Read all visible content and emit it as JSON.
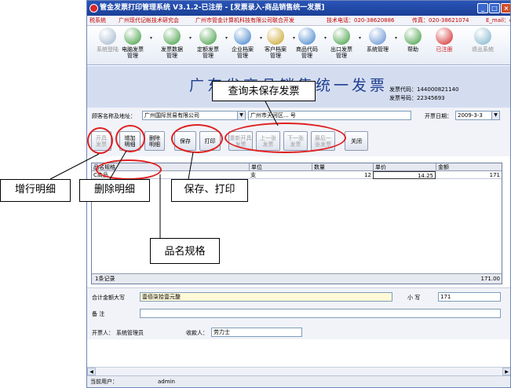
{
  "window": {
    "title": "管金发票打印管理系统 V3.1.2-已注册 - [发票录入-商品销售统一发票]",
    "controls": [
      "_",
      "□",
      "×"
    ]
  },
  "infobar": {
    "system": "税系统",
    "research": "广州现代记帐技术研究会",
    "company": "广州市管金计算机科技有限公司联合开发",
    "phone": "技术电话：020-38620886",
    "fax": "传真：020-38621074",
    "email": "E_mail：ev"
  },
  "toolbar": {
    "items": [
      {
        "label": "系统登陆",
        "icon": "login-icon",
        "color": "#9fb6cc",
        "disabled": true
      },
      {
        "label": "电脑发票\n管理",
        "icon": "computer-invoice-icon",
        "color": "#3a9a3a",
        "disabled": false
      },
      {
        "label": "发票数据\n管理",
        "icon": "invoice-data-icon",
        "color": "#3a9a3a",
        "disabled": false
      },
      {
        "label": "定额发票\n管理",
        "icon": "fixed-invoice-icon",
        "color": "#3a9a3a",
        "disabled": false
      },
      {
        "label": "企业档案\n管理",
        "icon": "enterprise-file-icon",
        "color": "#3a7ec8",
        "disabled": false
      },
      {
        "label": "客户档案\n管理",
        "icon": "customer-file-icon",
        "color": "#c8a020",
        "disabled": false
      },
      {
        "label": "商品代码\n管理",
        "icon": "product-code-icon",
        "color": "#3a7ec8",
        "disabled": false
      },
      {
        "label": "出口发票\n管理",
        "icon": "export-invoice-icon",
        "color": "#3a9a3a",
        "disabled": false
      },
      {
        "label": "系统管理",
        "icon": "system-manage-icon",
        "color": "#5a8ad0",
        "disabled": false
      },
      {
        "label": "帮助",
        "icon": "help-icon",
        "color": "#3a9a3a",
        "disabled": false
      },
      {
        "label": "已注册",
        "icon": "registered-icon",
        "color": "#d02020",
        "disabled": false
      },
      {
        "label": "退出系统",
        "icon": "exit-icon",
        "color": "#7ab0c8",
        "disabled": true
      }
    ]
  },
  "invoice": {
    "title": "广东省商品销售统一发票",
    "code_label": "发票代码：",
    "code": "144000821140",
    "number_label": "发票号码：",
    "number": "22345693"
  },
  "customer": {
    "label": "顾客名称及地址：",
    "name": "广州国际贸易有限公司",
    "address": "广州市天河区... 号",
    "date_label": "开票日期：",
    "date": "2009-3-3"
  },
  "actions": {
    "open": "开具\n发票",
    "add_detail": "增加\n明细",
    "delete_detail": "删除\n明细",
    "save": "保存",
    "print": "打印",
    "reopen": "重新开具\n发票",
    "prev": "上一张\n发票",
    "next": "下一张\n发票",
    "last": "最后一\n张发票",
    "close": "关闭"
  },
  "grid": {
    "columns": [
      "品名规格",
      "单位",
      "数量",
      "单价",
      "金额"
    ],
    "rows": [
      {
        "name": "C商品",
        "unit": "支",
        "qty": "12",
        "price": "14.25",
        "amount": "171"
      }
    ],
    "record_count": "1条记录",
    "total": "171.00"
  },
  "totals": {
    "amount_cn_label": "合计金额大写",
    "amount_cn": "壹佰柒拾壹元整",
    "small_label": "小  写",
    "small_value": "171",
    "remark_label": "备    注",
    "remark": ""
  },
  "signatures": {
    "issuer_label": "开票人：",
    "issuer": "系统管理员",
    "receiver_label": "收款人：",
    "receiver": "劳力士"
  },
  "status": {
    "user_label": "当前用户：",
    "user": "admin"
  },
  "callouts": {
    "query": "查询未保存发票",
    "add_row": "增行明细",
    "delete_detail": "删除明细",
    "save_print": "保存、打印",
    "product_spec": "品名规格"
  },
  "colors": {
    "title_bar": "#1f4aa8",
    "banner": "#d4ddf0",
    "annotation_red": "#e02020"
  }
}
